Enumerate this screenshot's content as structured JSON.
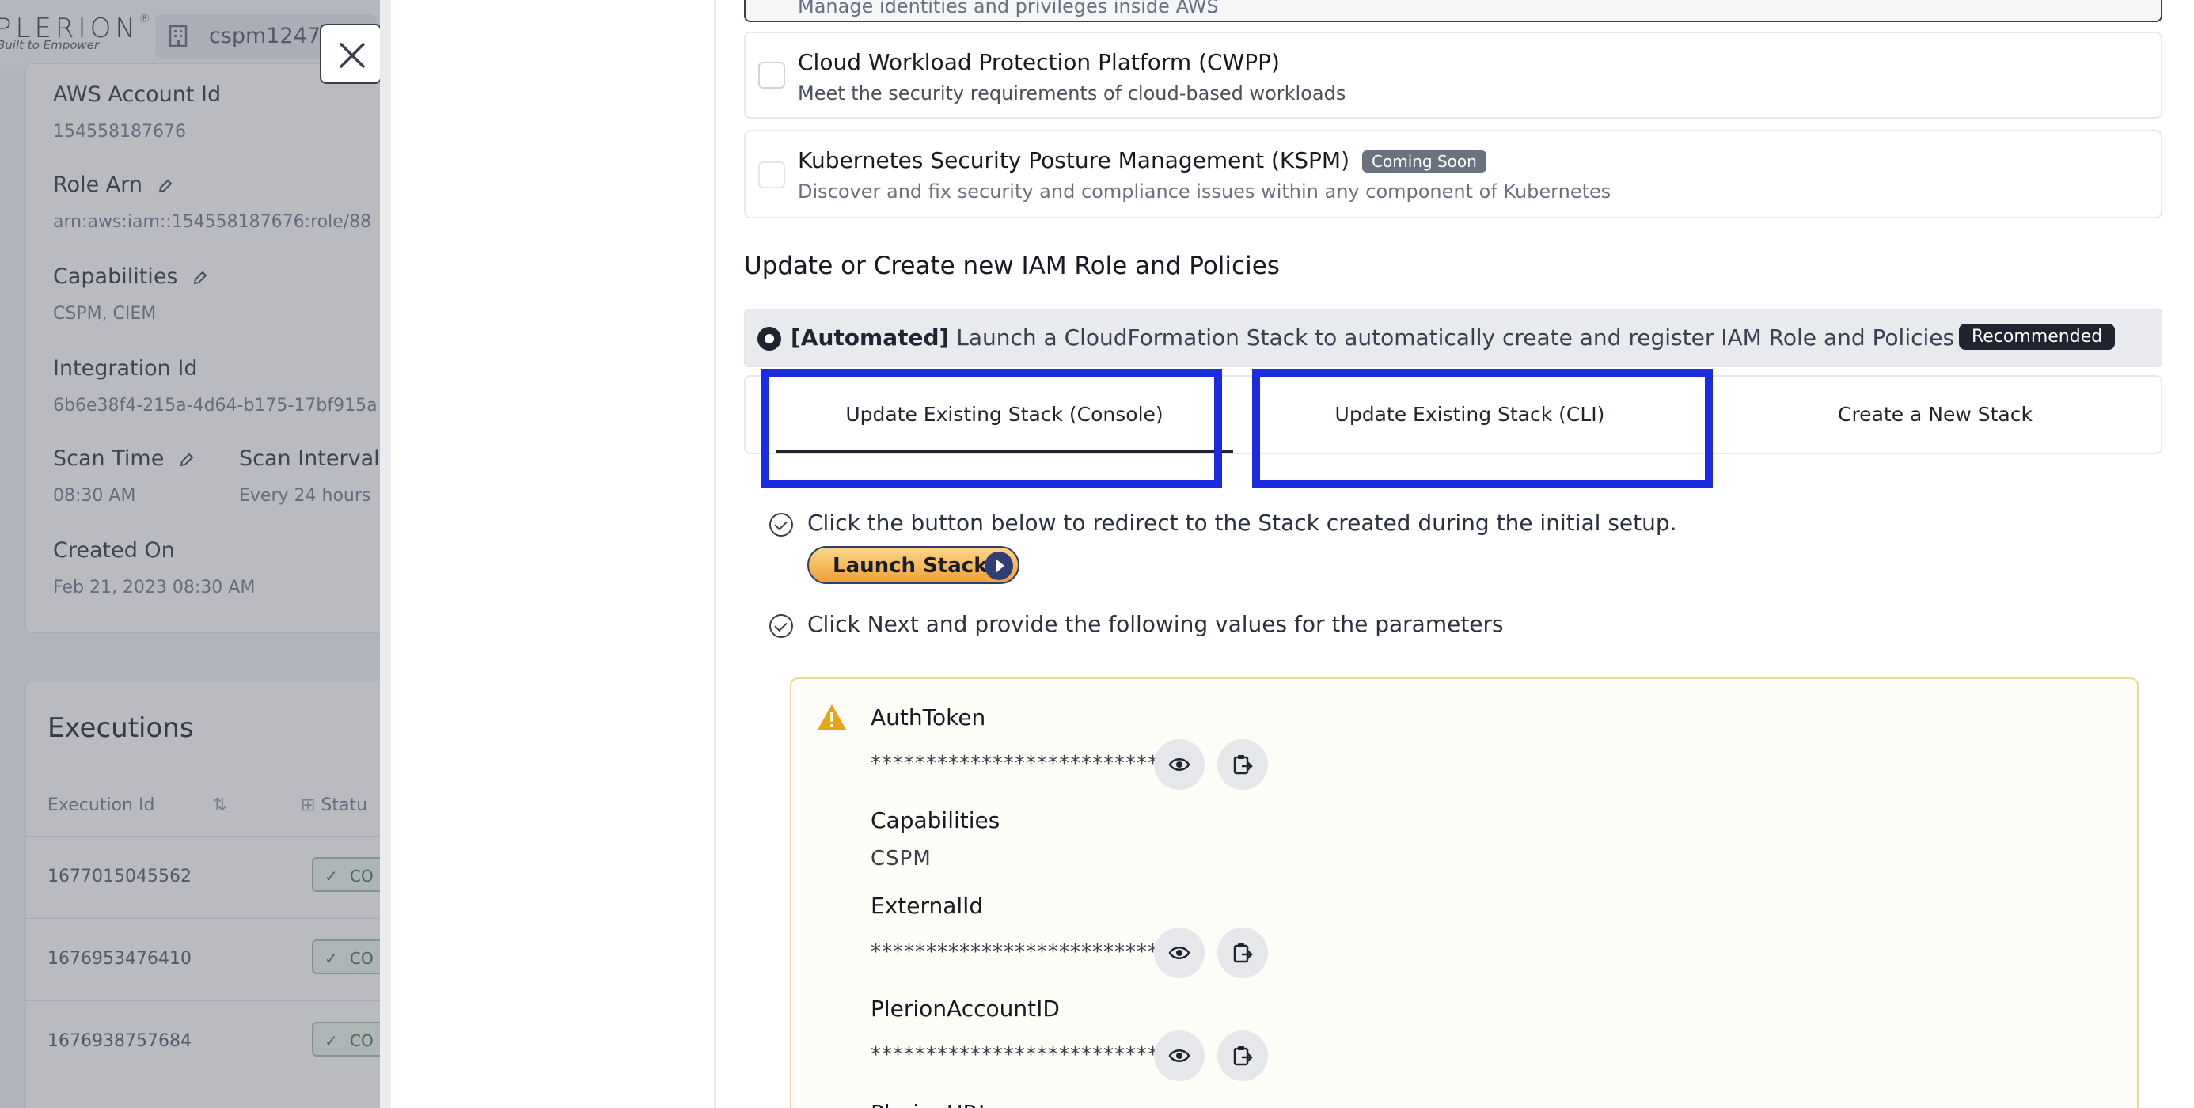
{
  "background": {
    "logo_text": "PLERION",
    "logo_reg": "®",
    "logo_tagline": "Built to Empower",
    "tenant": "cspm1247",
    "fields": [
      {
        "label": "AWS Account Id",
        "value": "154558187676"
      },
      {
        "label": "Role Arn",
        "value": "arn:aws:iam::154558187676:role/88"
      },
      {
        "label": "Capabilities",
        "value": "CSPM, CIEM"
      },
      {
        "label": "Integration Id",
        "value": "6b6e38f4-215a-4d64-b175-17bf915a"
      },
      {
        "label": "Scan Time",
        "value": "08:30 AM"
      },
      {
        "label": "Scan Interval",
        "value": "Every 24 hours"
      },
      {
        "label": "Created On",
        "value": "Feb 21, 2023 08:30 AM"
      }
    ],
    "executions": {
      "title": "Executions",
      "col_id": "Execution Id",
      "col_status": "Statu",
      "rows": [
        {
          "id": "1677015045562",
          "status": "CO"
        },
        {
          "id": "1676953476410",
          "status": "CO"
        },
        {
          "id": "1676938757684",
          "status": "CO"
        }
      ]
    }
  },
  "drawer": {
    "partial_top_text": "Manage identities and privileges inside AWS",
    "capabilities": [
      {
        "title": "Cloud Workload Protection Platform (CWPP)",
        "desc": "Meet the security requirements of cloud-based workloads",
        "badge": ""
      },
      {
        "title": "Kubernetes Security Posture Management (KSPM)",
        "desc": "Discover and fix security and compliance issues within any component of Kubernetes",
        "badge": "Coming Soon"
      }
    ],
    "section_title": "Update or Create new IAM Role and Policies",
    "automated": {
      "tag": "[Automated]",
      "text": "Launch a CloudFormation Stack to automatically create and register IAM Role and Policies required.",
      "badge": "Recommended"
    },
    "tabs": [
      {
        "label": "Update Existing Stack (Console)",
        "active": true
      },
      {
        "label": "Update Existing Stack (CLI)",
        "active": false
      },
      {
        "label": "Create a New Stack",
        "active": false
      }
    ],
    "steps": [
      "Click the button below to redirect to the Stack created during the initial setup.",
      "Click Next and provide the following values for the parameters"
    ],
    "launch_button": "Launch Stack",
    "params": [
      {
        "name": "AuthToken",
        "value": "**************************",
        "masked": true
      },
      {
        "name": "Capabilities",
        "value": "CSPM",
        "masked": false
      },
      {
        "name": "ExternalId",
        "value": "**************************",
        "masked": true
      },
      {
        "name": "PlerionAccountID",
        "value": "**************************",
        "masked": true
      },
      {
        "name": "PlerionURL",
        "value": "",
        "masked": false
      }
    ]
  },
  "colors": {
    "highlight": "#1a2be0",
    "accent_dark": "#1f2430",
    "warning": "#e8a317",
    "launch_orange": "#f2a033"
  }
}
